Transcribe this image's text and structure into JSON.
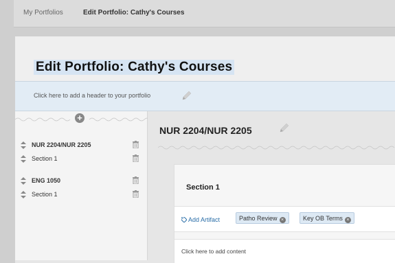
{
  "breadcrumb": {
    "link": "My Portfolios",
    "current": "Edit Portfolio: Cathy's Courses"
  },
  "portfolio": {
    "title": "Edit Portfolio: Cathy's Courses",
    "header_hint": "Click here to add a header to your portfolio"
  },
  "sidebar": {
    "items": [
      {
        "label": "NUR 2204/NUR 2205",
        "bold": true
      },
      {
        "label": "Section 1",
        "bold": false
      },
      {
        "label": "ENG 1050",
        "bold": true
      },
      {
        "label": "Section 1",
        "bold": false
      }
    ]
  },
  "page": {
    "heading": "NUR 2204/NUR 2205"
  },
  "section": {
    "title": "Section 1",
    "add_artifact_label": "Add Artifact",
    "artifacts": [
      "Patho Review",
      "Key OB Terms"
    ],
    "add_content_hint": "Click here to add content"
  },
  "colors": {
    "accent_link": "#2a6ea8",
    "tag_bg": "#dde9f4",
    "header_strip_bg": "#e2ecf5"
  }
}
